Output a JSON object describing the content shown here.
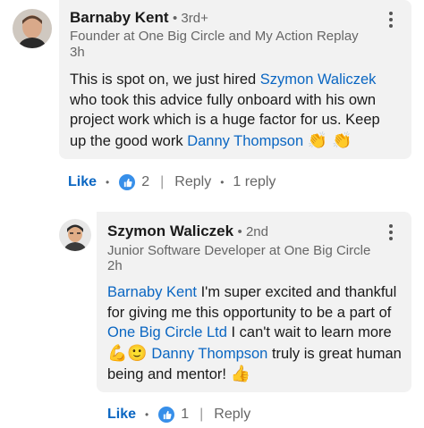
{
  "comment": {
    "author": "Barnaby Kent",
    "degree": "• 3rd+",
    "headline": "Founder at One Big Circle and My Action Replay",
    "time": "3h",
    "text_1": "This is spot on, we just hired",
    "mention_1": "Szymon Waliczek",
    "text_2": "who took this advice fully onboard with his own project work which is a huge factor for us. Keep up the good work",
    "mention_2": "Danny Thompson",
    "emoji": "👏 👏",
    "like_label": "Like",
    "reaction_count": "2",
    "reply_label": "Reply",
    "reply_count": "1 reply"
  },
  "reply": {
    "author": "Szymon Waliczek",
    "degree": "• 2nd",
    "headline": "Junior Software Developer at One Big Circle",
    "time": "2h",
    "mention_1": "Barnaby Kent",
    "text_1": "I'm super excited and thankful for giving me this opportunity to be a part of",
    "mention_2": "One Big Circle Ltd",
    "text_2": "I can't wait to learn more",
    "emoji_1": "💪🙂",
    "mention_3": "Danny Thompson",
    "text_3": "truly is great human being and mentor!",
    "emoji_2": "👍",
    "like_label": "Like",
    "reaction_count": "1",
    "reply_label": "Reply"
  },
  "colors": {
    "link": "#0a66c2",
    "bubble": "#f2f2f2",
    "muted": "#666666"
  }
}
